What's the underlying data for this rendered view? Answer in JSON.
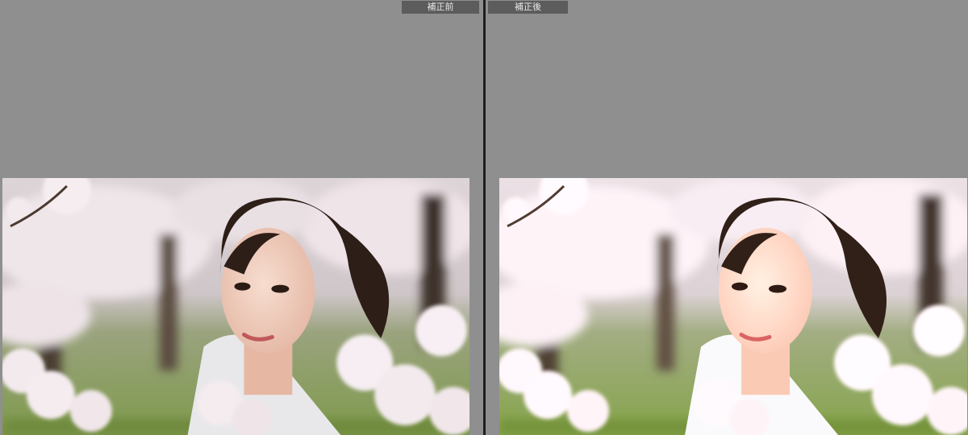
{
  "view": {
    "before_label": "補正前",
    "after_label": "補正後"
  },
  "icons": {
    "before_photo": "photo-image",
    "after_photo": "photo-image"
  },
  "colors": {
    "background": "#8f8f8f",
    "divider": "#1e1e1e",
    "label_bg": "#5c5c5c",
    "label_text": "#e8e8e8"
  }
}
